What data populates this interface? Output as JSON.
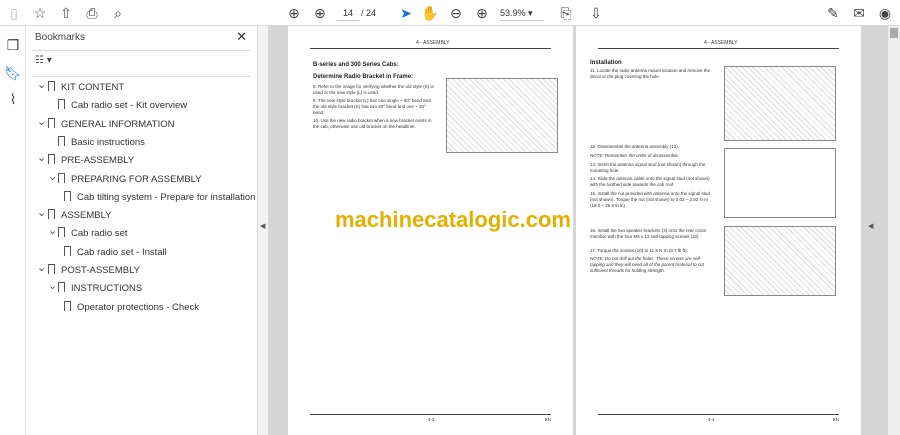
{
  "toolbar": {
    "page_current": "14",
    "page_total": "/ 24",
    "zoom": "53.9%"
  },
  "bookmarks": {
    "title": "Bookmarks",
    "items": [
      {
        "label": "KIT CONTENT",
        "level": 0,
        "expanded": true
      },
      {
        "label": "Cab radio set - Kit overview",
        "level": 1
      },
      {
        "label": "GENERAL INFORMATION",
        "level": 0,
        "expanded": true
      },
      {
        "label": "Basic instructions",
        "level": 1
      },
      {
        "label": "PRE-ASSEMBLY",
        "level": 0,
        "expanded": true
      },
      {
        "label": "PREPARING FOR ASSEMBLY",
        "level": 1,
        "expanded": true
      },
      {
        "label": "Cab tilting system - Prepare for installation",
        "level": 2
      },
      {
        "label": "ASSEMBLY",
        "level": 0,
        "expanded": true
      },
      {
        "label": "Cab radio set",
        "level": 1,
        "expanded": true
      },
      {
        "label": "Cab radio set - Install",
        "level": 2
      },
      {
        "label": "POST-ASSEMBLY",
        "level": 0,
        "expanded": true
      },
      {
        "label": "INSTRUCTIONS",
        "level": 1,
        "expanded": true
      },
      {
        "label": "Operator protections - Check",
        "level": 2
      }
    ]
  },
  "watermark": "machinecatalogic.com",
  "left_page": {
    "header": "4 - ASSEMBLY",
    "title": "B-series and 300 Series Cabs:",
    "subtitle": "Determine Radio Bracket in Frame:",
    "steps": [
      "8.  Refer to the image for verifying whether the old style (K) is used or the new style (L) is used.",
      "9.  The new style bracket (L) has one single ~ 60° bend and the old style bracket (K) has two 60° bend and one ~ 30° bend.",
      "10. Use the new radio bracket when a new bracket exists in the cab, otherwise use old bracket on the headliner."
    ],
    "footer": "4-3",
    "lang": "EN"
  },
  "right_page": {
    "header": "4 - ASSEMBLY",
    "title": "Installation",
    "steps": [
      "11. Locate the radio antenna mount location and remove the decal or the plug covering the hole.",
      "12. Disassemble the antenna assembly (12).",
      "NOTE: Remember the order of disassemble.",
      "13. Insert the antenna signal stud (not shown) through the mounting hole.",
      "14. Slide the antenna cable onto the signal stud (not shown) with the toothed side towards the cab roof.",
      "15. Install the nut provided with antenna onto the signal stud (not shown). Torque the nut (not shown) to 2.03 – 2.93 N·m (18.0 – 25.9 lb in).",
      "16. Install the two speaker brackets (3) onto the rear cross member with the four M5 x 13 self-tapping screws (10).",
      "17. Torque the screws (10) to 11.8 N·m (8.7 lb ft).",
      "NOTE: Do not drill out the holes. These screws are self-tapping and they will need all of the parent material to cut sufficient threads for holding strength."
    ],
    "footer": "4-4",
    "lang": "EN"
  }
}
